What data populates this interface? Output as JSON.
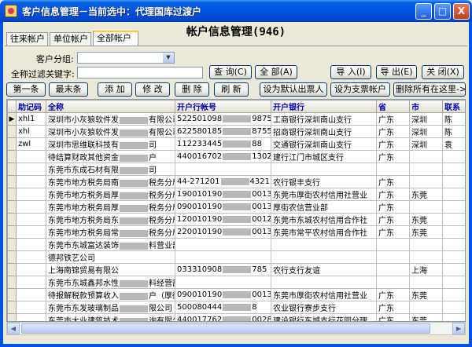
{
  "window": {
    "title": "客户信息管理－当前选中：代理国库过渡户",
    "minimize": "_",
    "maximize": "□",
    "close": "X"
  },
  "main_title": "帐户信息管理(946)",
  "tabs": [
    "往来帐户",
    "单位帐户",
    "全部帐户"
  ],
  "filters": {
    "group_label": "客户分组:",
    "keyword_label": "全称过滤关键字:",
    "keyword_value": ""
  },
  "buttons_row1": {
    "query": "查 询(C)",
    "all": "全 部(A)",
    "import": "导 入(I)",
    "export": "导 出(E)",
    "close": "关 闭(X)"
  },
  "buttons_row2": {
    "first": "第一条",
    "last": "最末条",
    "add": "添 加",
    "edit": "修 改",
    "delete": "删 除",
    "refresh": "刷 新",
    "default_payee": "设为默认出票人",
    "set_check": "设为支票帐户",
    "delete_all": "删除所有在这里->"
  },
  "table": {
    "headers": [
      "助记码",
      "全称",
      "开户行帐号",
      "开户银行",
      "省",
      "市",
      "联系"
    ],
    "rows": [
      {
        "cur": "▶",
        "code": "xhl1",
        "name": "深圳市小灰狼软件发",
        "name2": "有限公司",
        "acct": "522501098",
        "acct2": "987599",
        "bank": "工商银行深圳南山支行",
        "prov": "广东",
        "city": "深圳",
        "contact": "陈"
      },
      {
        "cur": "",
        "code": "xhl",
        "name": "深圳市小灰狼软件发",
        "name2": "有限公司",
        "acct": "622580185",
        "acct2": "87555",
        "bank": "招商银行深圳南山支行",
        "prov": "广东",
        "city": "深圳",
        "contact": "陈"
      },
      {
        "cur": "",
        "code": "zwl",
        "name": "深圳市思维联科技有",
        "name2": "司",
        "acct": "112233445",
        "acct2": "88",
        "bank": "交通银行深圳南山支行",
        "prov": "广东",
        "city": "深圳",
        "contact": "袁"
      },
      {
        "cur": "",
        "code": "",
        "name": "待结算财政其他资金",
        "name2": "户",
        "acct": "440016702",
        "acct2": "130202",
        "bank": "建行江门市城区支行",
        "prov": "广东",
        "city": "",
        "contact": ""
      },
      {
        "cur": "",
        "code": "",
        "name": "东莞市东成石材有限",
        "name2": "司",
        "acct": "",
        "acct2": "",
        "bank": "",
        "prov": "",
        "city": "",
        "contact": ""
      },
      {
        "cur": "",
        "code": "",
        "name": "东莞市地方税务局南",
        "name2": "税务分局",
        "acct": "44-271201",
        "acct2": "4321",
        "bank": "农行银丰支行",
        "prov": "广东",
        "city": "",
        "contact": ""
      },
      {
        "cur": "",
        "code": "",
        "name": "东莞市地方税务局厚",
        "name2": "税务分局",
        "acct": "190010190",
        "acct2": "0013",
        "bank": "东莞市厚街农村信用社营业",
        "prov": "广东",
        "city": "东莞",
        "contact": ""
      },
      {
        "cur": "",
        "code": "",
        "name": "东莞市地方税务局厚",
        "name2": "税务分局",
        "acct": "090010190",
        "acct2": "0013",
        "bank": "厚街农信营业部",
        "prov": "广东",
        "city": "",
        "contact": ""
      },
      {
        "cur": "",
        "code": "",
        "name": "东莞市地方税务局东",
        "name2": "税务分局",
        "acct": "120010190",
        "acct2": "0012",
        "bank": "东莞市东城农村信用合作社",
        "prov": "广东",
        "city": "东莞",
        "contact": ""
      },
      {
        "cur": "",
        "code": "",
        "name": "东莞市地方税务局常",
        "name2": "税务分局",
        "acct": "220010190",
        "acct2": "0013",
        "bank": "东莞市常平农村信用合作社",
        "prov": "广东",
        "city": "东莞",
        "contact": ""
      },
      {
        "cur": "",
        "code": "",
        "name": "东莞市东城富达装饰",
        "name2": "料营业部",
        "acct": "",
        "acct2": "",
        "bank": "",
        "prov": "",
        "city": "",
        "contact": ""
      },
      {
        "cur": "",
        "code": "",
        "name": "德邦铁艺公司",
        "name2": "",
        "acct": "",
        "acct2": "",
        "bank": "",
        "prov": "",
        "city": "",
        "contact": ""
      },
      {
        "cur": "",
        "code": "",
        "name": "上海南锦贸易有限公",
        "name2": "",
        "acct": "033310908",
        "acct2": "785",
        "bank": "农行支行友谊",
        "prov": "",
        "city": "上海",
        "contact": ""
      },
      {
        "cur": "",
        "code": "",
        "name": "东莞市东城鑫邦水性",
        "name2": "料经营部",
        "acct": "",
        "acct2": "",
        "bank": "",
        "prov": "",
        "city": "",
        "contact": ""
      },
      {
        "cur": "",
        "code": "",
        "name": "待报解税款预算收入",
        "name2": "户（厚街）",
        "acct": "090010190",
        "acct2": "0013",
        "bank": "东莞市厚街农村信用社营业",
        "prov": "广东",
        "city": "东莞",
        "contact": ""
      },
      {
        "cur": "",
        "code": "",
        "name": "东莞市东发玻璃制品",
        "name2": "限公司",
        "acct": "500080444",
        "acct2": "8",
        "bank": "农业银行寮步支行",
        "prov": "广东",
        "city": "",
        "contact": ""
      },
      {
        "cur": "",
        "code": "",
        "name": "东莞市大业建筑技术",
        "name2": "询有限公司",
        "acct": "440017762",
        "acct2": "002815",
        "bank": "建设银行东城支行花园分理",
        "prov": "广东",
        "city": "东莞",
        "contact": ""
      },
      {
        "cur": "",
        "code": "",
        "name": "大连实德塑胶工业有",
        "name2": "公司深圳分公",
        "acct": "",
        "acct2": "",
        "bank": "",
        "prov": "",
        "city": "",
        "contact": ""
      }
    ]
  }
}
